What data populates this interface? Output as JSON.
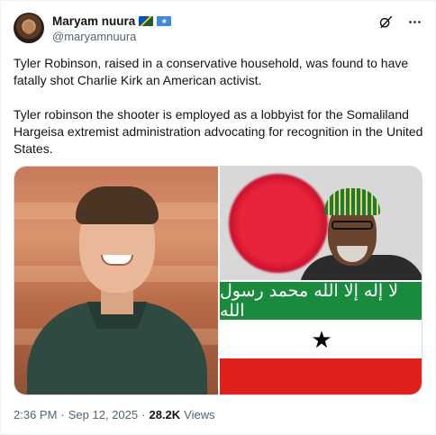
{
  "author": {
    "display_name": "Maryam nuura",
    "handle": "@maryamnuura",
    "badge_emojis": [
      "flag-solomon-islands-icon",
      "flag-somalia-icon"
    ]
  },
  "tweet": {
    "paragraphs": [
      "Tyler Robinson, raised in a conservative household, was found to have fatally shot Charlie Kirk an American activist.",
      "Tyler robinson the shooter is employed as a lobbyist for the Somaliland Hargeisa extremist administration advocating for recognition in the United States."
    ]
  },
  "media": {
    "flag_inscription": "لا إله إلا الله محمد رسول الله",
    "flag_colors": {
      "green": "#1a8a3c",
      "white": "#ffffff",
      "red": "#e0201b",
      "star": "#000000"
    }
  },
  "meta": {
    "time": "2:36 PM",
    "separator": "·",
    "date": "Sep 12, 2025",
    "views_separator": "·",
    "views_count": "28.2K",
    "views_label": "Views"
  },
  "icons": {
    "grok": "grok-icon",
    "more": "more-icon"
  }
}
